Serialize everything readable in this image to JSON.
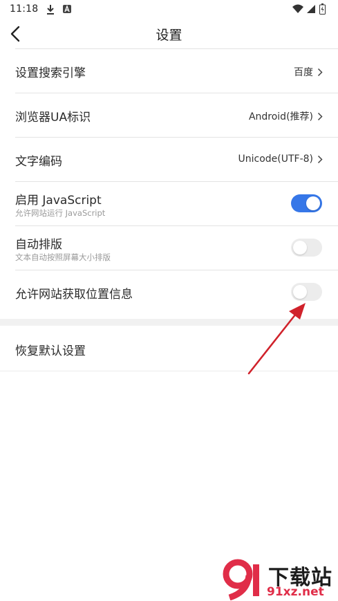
{
  "status_bar": {
    "time": "11:18",
    "icons": [
      "download-icon",
      "a-badge-icon",
      "wifi-icon",
      "signal-icon",
      "battery-icon"
    ]
  },
  "header": {
    "title": "设置",
    "back_icon": "back-arrow-icon"
  },
  "settings": [
    {
      "label": "设置搜索引擎",
      "value": "百度"
    },
    {
      "label": "浏览器UA标识",
      "value": "Android(推荐)"
    },
    {
      "label": "文字编码",
      "value": "Unicode(UTF-8)"
    },
    {
      "label": "启用 JavaScript",
      "sub": "允许网站运行 JavaScript",
      "toggle": true
    },
    {
      "label": "自动排版",
      "sub": "文本自动按照屏幕大小排版",
      "toggle": false
    },
    {
      "label": "允许网站获取位置信息",
      "toggle": false
    }
  ],
  "reset": {
    "label": "恢复默认设置"
  },
  "watermark": {
    "logo": "9",
    "text_top": "下载站",
    "text_bottom": "91xz.net"
  },
  "colors": {
    "toggle_on": "#3677e8",
    "toggle_off": "#ececec",
    "annotation_arrow": "#d0222b",
    "watermark_red": "#e02d48"
  }
}
